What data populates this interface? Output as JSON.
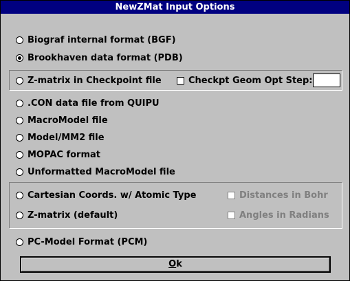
{
  "window": {
    "title": "NewZMat Input Options"
  },
  "options": {
    "bgf": "Biograf internal format (BGF)",
    "pdb": "Brookhaven data format (PDB)",
    "zmat_checkpoint": "Z-matrix in Checkpoint file",
    "checkpt_geom_label": "Checkpt Geom Opt Step:",
    "checkpt_geom_value": "",
    "con": ".CON data file from QUIPU",
    "macromodel": "MacroModel file",
    "mm2": "Model/MM2 file",
    "mopac": "MOPAC format",
    "unformatted_macromodel": "Unformatted MacroModel file",
    "cartesian": "Cartesian Coords. w/ Atomic Type",
    "distances_bohr": "Distances in Bohr",
    "zmatrix_default": "Z-matrix (default)",
    "angles_radians": "Angles in Radians",
    "pcm": "PC-Model Format (PCM)"
  },
  "buttons": {
    "ok_prefix": "O",
    "ok_rest": "k"
  },
  "selected": "pdb"
}
